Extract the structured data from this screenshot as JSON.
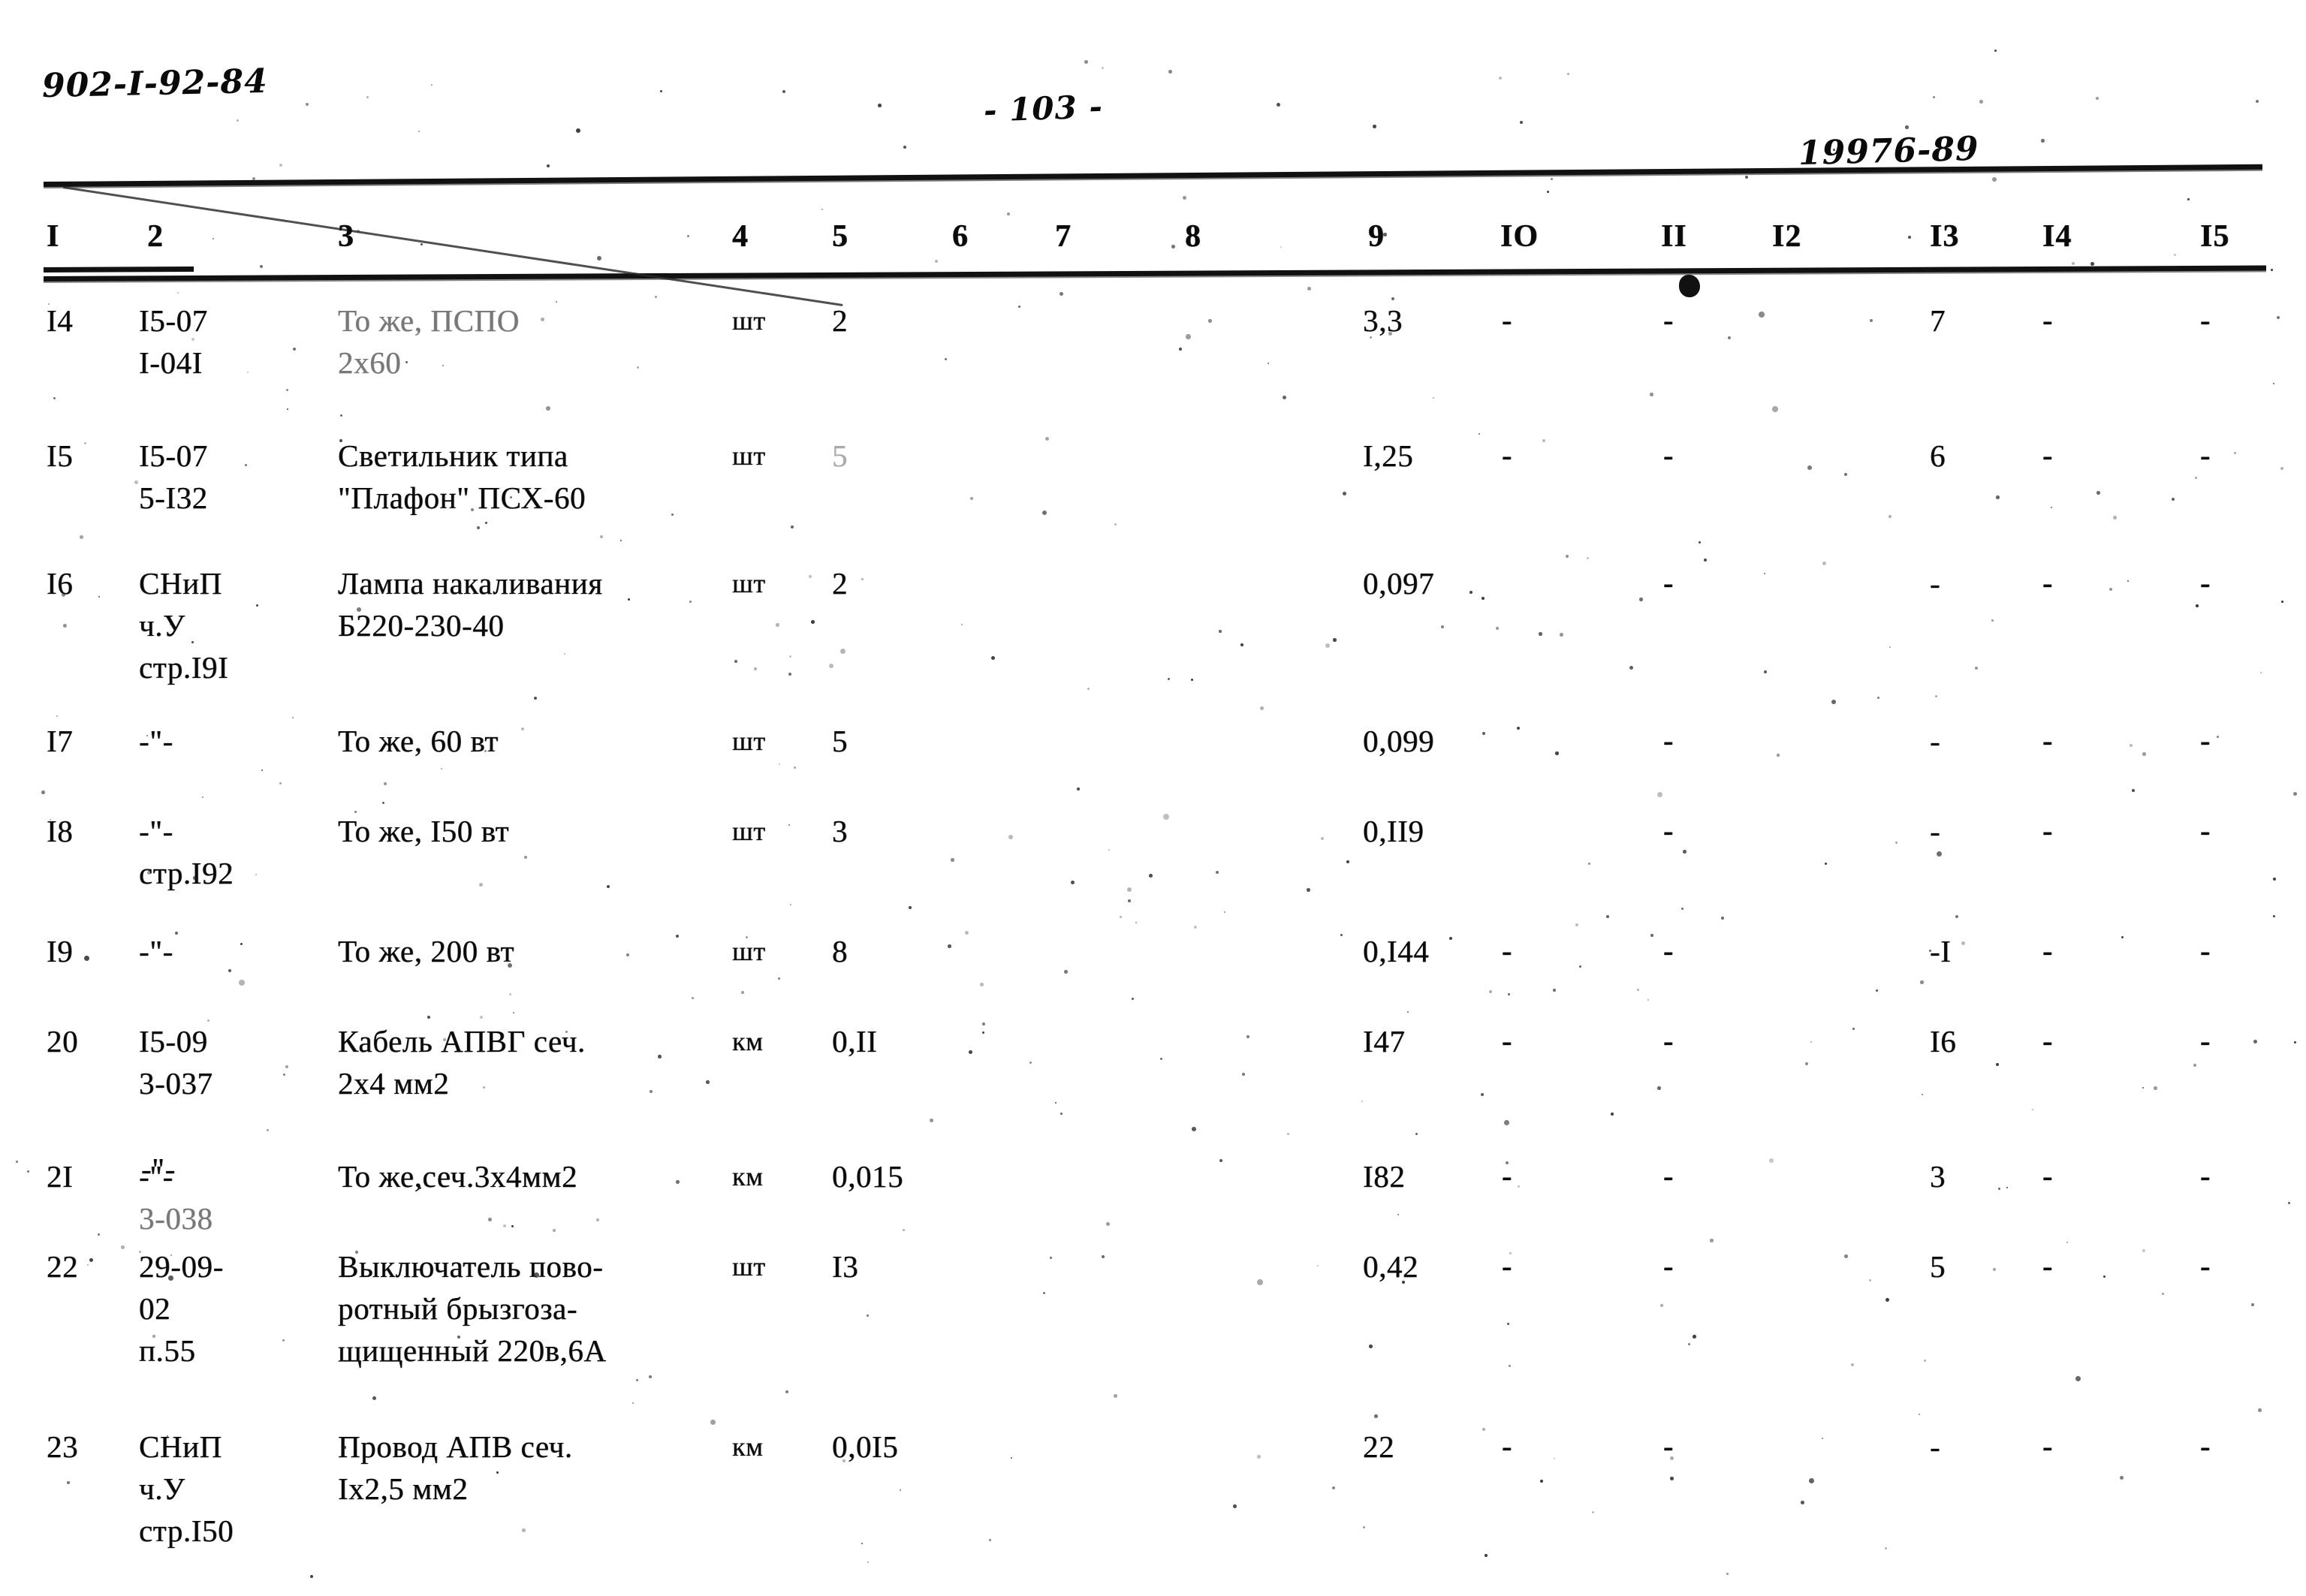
{
  "header": {
    "doc_code": "902-I-92-84",
    "page_number": "- 103 -",
    "doc_number": "19976-89"
  },
  "table": {
    "column_headers": [
      "I",
      "2",
      "3",
      "4",
      "5",
      "6",
      "7",
      "8",
      "9",
      "IO",
      "II",
      "I2",
      "I3",
      "I4",
      "I5"
    ],
    "rows": [
      {
        "c1": "I4",
        "c2": [
          "I5-07",
          "I-04I"
        ],
        "c3": [
          "То же, ПСПО",
          "2х60"
        ],
        "c4": "шт",
        "c5": "2",
        "c6": "",
        "c7": "",
        "c8": "",
        "c9": "3,3",
        "c10": "-",
        "c11": "-",
        "c12": "",
        "c13": "7",
        "c14": "-",
        "c15": "-"
      },
      {
        "c1": "I5",
        "c2": [
          "I5-07",
          "5-I32"
        ],
        "c3": [
          "Светильник типа",
          "\"Плафон\" ПСХ-60"
        ],
        "c4": "шт",
        "c5": "5",
        "c6": "",
        "c7": "",
        "c8": "",
        "c9": "I,25",
        "c10": "-",
        "c11": "-",
        "c12": "",
        "c13": "6",
        "c14": "-",
        "c15": "-"
      },
      {
        "c1": "I6",
        "c2": [
          "СНиП",
          "ч.У",
          "стр.I9I"
        ],
        "c3": [
          "Лампа накаливания",
          "Б220-230-40"
        ],
        "c4": "шт",
        "c5": "2",
        "c6": "",
        "c7": "",
        "c8": "",
        "c9": "0,097",
        "c10": "",
        "c11": "-",
        "c12": "",
        "c13": "-",
        "c14": "-",
        "c15": "-"
      },
      {
        "c1": "I7",
        "c2": [
          "-\"-"
        ],
        "c3": [
          "То же, 60 вт"
        ],
        "c4": "шт",
        "c5": "5",
        "c6": "",
        "c7": "",
        "c8": "",
        "c9": "0,099",
        "c10": "",
        "c11": "-",
        "c12": "",
        "c13": "-",
        "c14": "-",
        "c15": "-"
      },
      {
        "c1": "I8",
        "c2": [
          "-\"-",
          "стр.I92"
        ],
        "c3": [
          "То же, I50 вт"
        ],
        "c4": "шт",
        "c5": "3",
        "c6": "",
        "c7": "",
        "c8": "",
        "c9": "0,II9",
        "c10": "",
        "c11": "-",
        "c12": "",
        "c13": "-",
        "c14": "-",
        "c15": "-"
      },
      {
        "c1": "I9",
        "c2": [
          "-\"-"
        ],
        "c3": [
          "То же, 200 вт"
        ],
        "c4": "шт",
        "c5": "8",
        "c6": "",
        "c7": "",
        "c8": "",
        "c9": "0,I44",
        "c10": "-",
        "c11": "-",
        "c12": "",
        "c13": "-I",
        "c14": "-",
        "c15": "-"
      },
      {
        "c1": "20",
        "c2": [
          "I5-09",
          "3-037"
        ],
        "c3": [
          "Кабель АПВГ сеч.",
          "2х4 мм2"
        ],
        "c4": "км",
        "c5": "0,II",
        "c6": "",
        "c7": "",
        "c8": "",
        "c9": "I47",
        "c10": "-",
        "c11": "-",
        "c12": "",
        "c13": "I6",
        "c14": "-",
        "c15": "-"
      },
      {
        "c1": "2I",
        "c2": [
          "-\"-",
          "3-038"
        ],
        "c3": [
          "То же,сеч.3х4мм2"
        ],
        "c4": "км",
        "c5": "0,015",
        "c6": "",
        "c7": "",
        "c8": "",
        "c9": "I82",
        "c10": "-",
        "c11": "-",
        "c12": "",
        "c13": "3",
        "c14": "-",
        "c15": "-"
      },
      {
        "c1": "22",
        "c2": [
          "29-09-",
          "02",
          "п.55"
        ],
        "c3": [
          "Выключатель пово-",
          "ротный брызгоза-",
          "щищенный 220в,6А"
        ],
        "c4": "шт",
        "c5": "I3",
        "c6": "",
        "c7": "",
        "c8": "",
        "c9": "0,42",
        "c10": "-",
        "c11": "-",
        "c12": "",
        "c13": "5",
        "c14": "-",
        "c15": "-"
      },
      {
        "c1": "23",
        "c2": [
          "СНиП",
          "ч.У",
          "стр.I50"
        ],
        "c3": [
          "Провод АПВ сеч.",
          "Iх2,5 мм2"
        ],
        "c4": "км",
        "c5": "0,0I5",
        "c6": "",
        "c7": "",
        "c8": "",
        "c9": "22",
        "c10": "-",
        "c11": "-",
        "c12": "",
        "c13": "-",
        "c14": "-",
        "c15": "-"
      }
    ]
  }
}
